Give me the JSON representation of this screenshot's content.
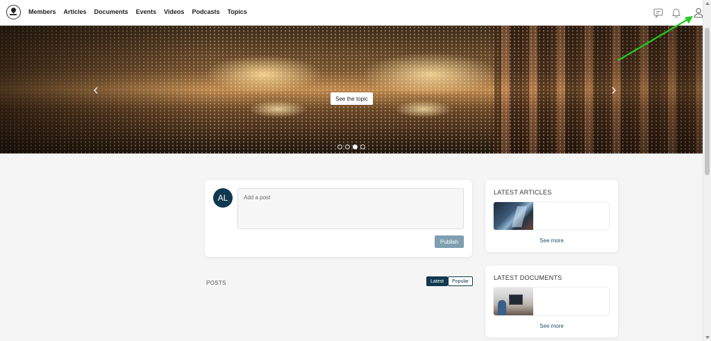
{
  "nav": {
    "items": [
      "Members",
      "Articles",
      "Documents",
      "Events",
      "Videos",
      "Podcasts",
      "Topics"
    ]
  },
  "icons": {
    "logo": "map-pin-logo-icon",
    "messages": "chat-icon",
    "notifications": "bell-icon",
    "profile": "user-icon"
  },
  "hero": {
    "button_label": "See the topic",
    "prev_arrow": "‹",
    "next_arrow": "›",
    "slide_count": 4,
    "active_slide": 3
  },
  "composer": {
    "avatar_initials": "AL",
    "placeholder": "Add a post",
    "publish_label": "Publish"
  },
  "posts": {
    "label": "POSTS",
    "filter_latest": "Latest",
    "filter_popular": "Popular"
  },
  "sidebar": {
    "articles_title": "LATEST ARTICLES",
    "documents_title": "LATEST DOCUMENTS",
    "see_more": "See more"
  },
  "colors": {
    "primary": "#10384f",
    "publish_disabled": "#7f9fb0",
    "annotation_arrow": "#22cc22"
  }
}
